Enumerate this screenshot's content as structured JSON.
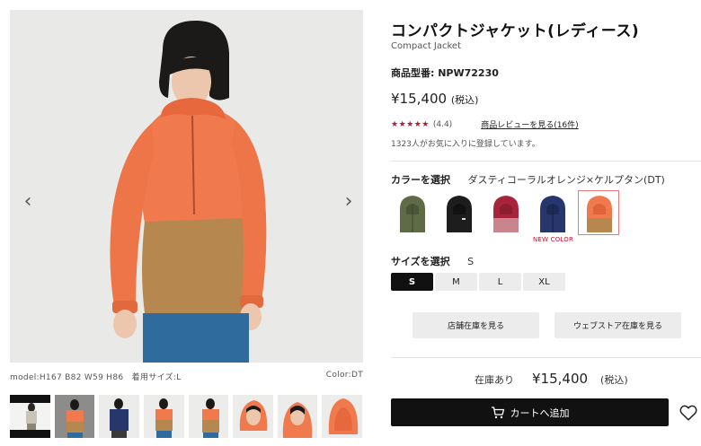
{
  "gallery": {
    "prev_arrow": "‹",
    "next_arrow": "›",
    "caption_left": "model:H167 B82 W59 H86　着用サイズ:L",
    "caption_right": "Color:DT"
  },
  "product": {
    "title": "コンパクトジャケット(レディース)",
    "subtitle": "Compact Jacket",
    "model_number": "商品型番: NPW72230",
    "price": "¥15,400",
    "tax_note": "(税込)",
    "stars": "★★★★★",
    "rating": "(4.4)",
    "review_link": "商品レビューを見る(16件)",
    "favorites": "1323人がお気に入りに登録しています。"
  },
  "colors": {
    "label": "カラーを選択",
    "selected_name": "ダスティコーラルオレンジ×ケルプタン(DT)",
    "new_badge": "NEW COLOR",
    "swatches": [
      {
        "name": "olive",
        "top": "#5f6a47",
        "bottom": "#5f6a47"
      },
      {
        "name": "black",
        "top": "#1d1d1d",
        "bottom": "#1d1d1d"
      },
      {
        "name": "red",
        "top": "#a8243a",
        "bottom": "#c9848e"
      },
      {
        "name": "navy",
        "top": "#27366b",
        "bottom": "#27366b"
      },
      {
        "name": "coral",
        "top": "#f07a4e",
        "bottom": "#b6884f"
      }
    ]
  },
  "sizes": {
    "label": "サイズを選択",
    "selected": "S",
    "options": [
      "S",
      "M",
      "L",
      "XL"
    ]
  },
  "stock": {
    "store_button": "店舗在庫を見る",
    "web_button": "ウェブストア在庫を見る",
    "status": "在庫あり",
    "price": "¥15,400",
    "tax_note": "(税込)"
  },
  "cart": {
    "button_label": "カートへ追加"
  },
  "palette": {
    "accent_red": "#c8102e",
    "jacket_orange": "#f07a4e",
    "jacket_tan": "#b6884f",
    "selected_border": "#e8777a"
  }
}
